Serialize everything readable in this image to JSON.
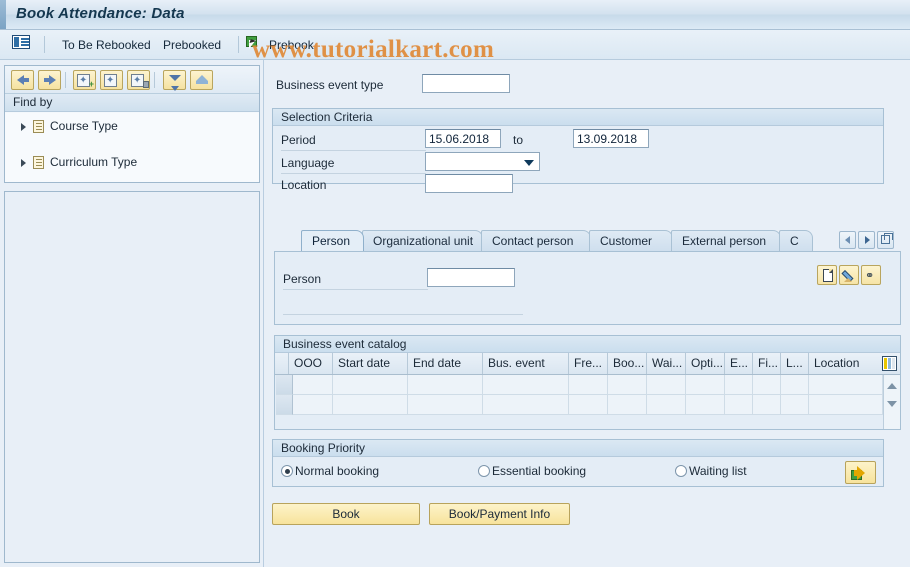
{
  "window": {
    "title": "Book Attendance: Data"
  },
  "watermark": "www.tutorialkart.com",
  "toolbar": {
    "list_icon_name": "list-detail-icon",
    "items": [
      {
        "label": "To Be Rebooked"
      },
      {
        "label": "Prebooked"
      },
      {
        "label": "Prebook"
      }
    ]
  },
  "sidebar": {
    "toolbar_icons": [
      "back-arrow-icon",
      "forward-arrow-icon",
      "create-entry-icon",
      "display-entry-icon",
      "delete-entry-icon",
      "collapse-all-icon",
      "expand-all-icon"
    ],
    "find_by_label": "Find by",
    "tree": [
      {
        "label": "Course Type"
      },
      {
        "label": "Curriculum Type"
      }
    ]
  },
  "main": {
    "business_event_type": {
      "label": "Business event type",
      "value": "",
      "placeholder": ""
    },
    "selection_criteria": {
      "title": "Selection Criteria",
      "period_label": "Period",
      "period_from": "15.06.2018",
      "to_label": "to",
      "period_to": "13.09.2018",
      "language_label": "Language",
      "language_value": "",
      "location_label": "Location",
      "location_value": ""
    },
    "tabs": [
      {
        "label": "Person",
        "active": true
      },
      {
        "label": "Organizational unit",
        "active": false
      },
      {
        "label": "Contact person",
        "active": false
      },
      {
        "label": "Customer",
        "active": false
      },
      {
        "label": "External person",
        "active": false
      },
      {
        "label": "C",
        "active": false
      }
    ],
    "tab_nav": {
      "prev_icon": "tab-scroll-left-icon",
      "next_icon": "tab-scroll-right-icon",
      "list_icon": "tab-list-icon"
    },
    "person_tab": {
      "label": "Person",
      "value": "",
      "action_icons": [
        "new-document-icon",
        "edit-pencil-icon",
        "display-glasses-icon"
      ]
    },
    "catalog": {
      "title": "Business event catalog",
      "columns": [
        "",
        "OOO",
        "Start date",
        "End date",
        "Bus. event",
        "Fre...",
        "Boo...",
        "Wai...",
        "Opti...",
        "E...",
        "Fi...",
        "L...",
        "Location"
      ],
      "rows": [
        [
          "",
          "",
          "",
          "",
          "",
          "",
          "",
          "",
          "",
          "",
          "",
          "",
          ""
        ],
        [
          "",
          "",
          "",
          "",
          "",
          "",
          "",
          "",
          "",
          "",
          "",
          "",
          ""
        ]
      ],
      "settings_icon": "table-settings-icon",
      "scroll_up_icon": "scroll-up-icon",
      "scroll_down_icon": "scroll-down-icon"
    },
    "booking_priority": {
      "title": "Booking Priority",
      "options": [
        {
          "label": "Normal booking",
          "selected": true
        },
        {
          "label": "Essential booking",
          "selected": false
        },
        {
          "label": "Waiting list",
          "selected": false
        }
      ],
      "execute_icon": "execute-arrow-icon"
    },
    "actions": [
      {
        "label": "Book"
      },
      {
        "label": "Book/Payment Info"
      }
    ]
  },
  "colors": {
    "window_bg": "#e8eff7",
    "title_text": "#14374f",
    "accent_gold": "#f7e39c",
    "watermark": "#e08a38",
    "group_bg": "#e4edf6",
    "border": "#a7c0d4"
  }
}
